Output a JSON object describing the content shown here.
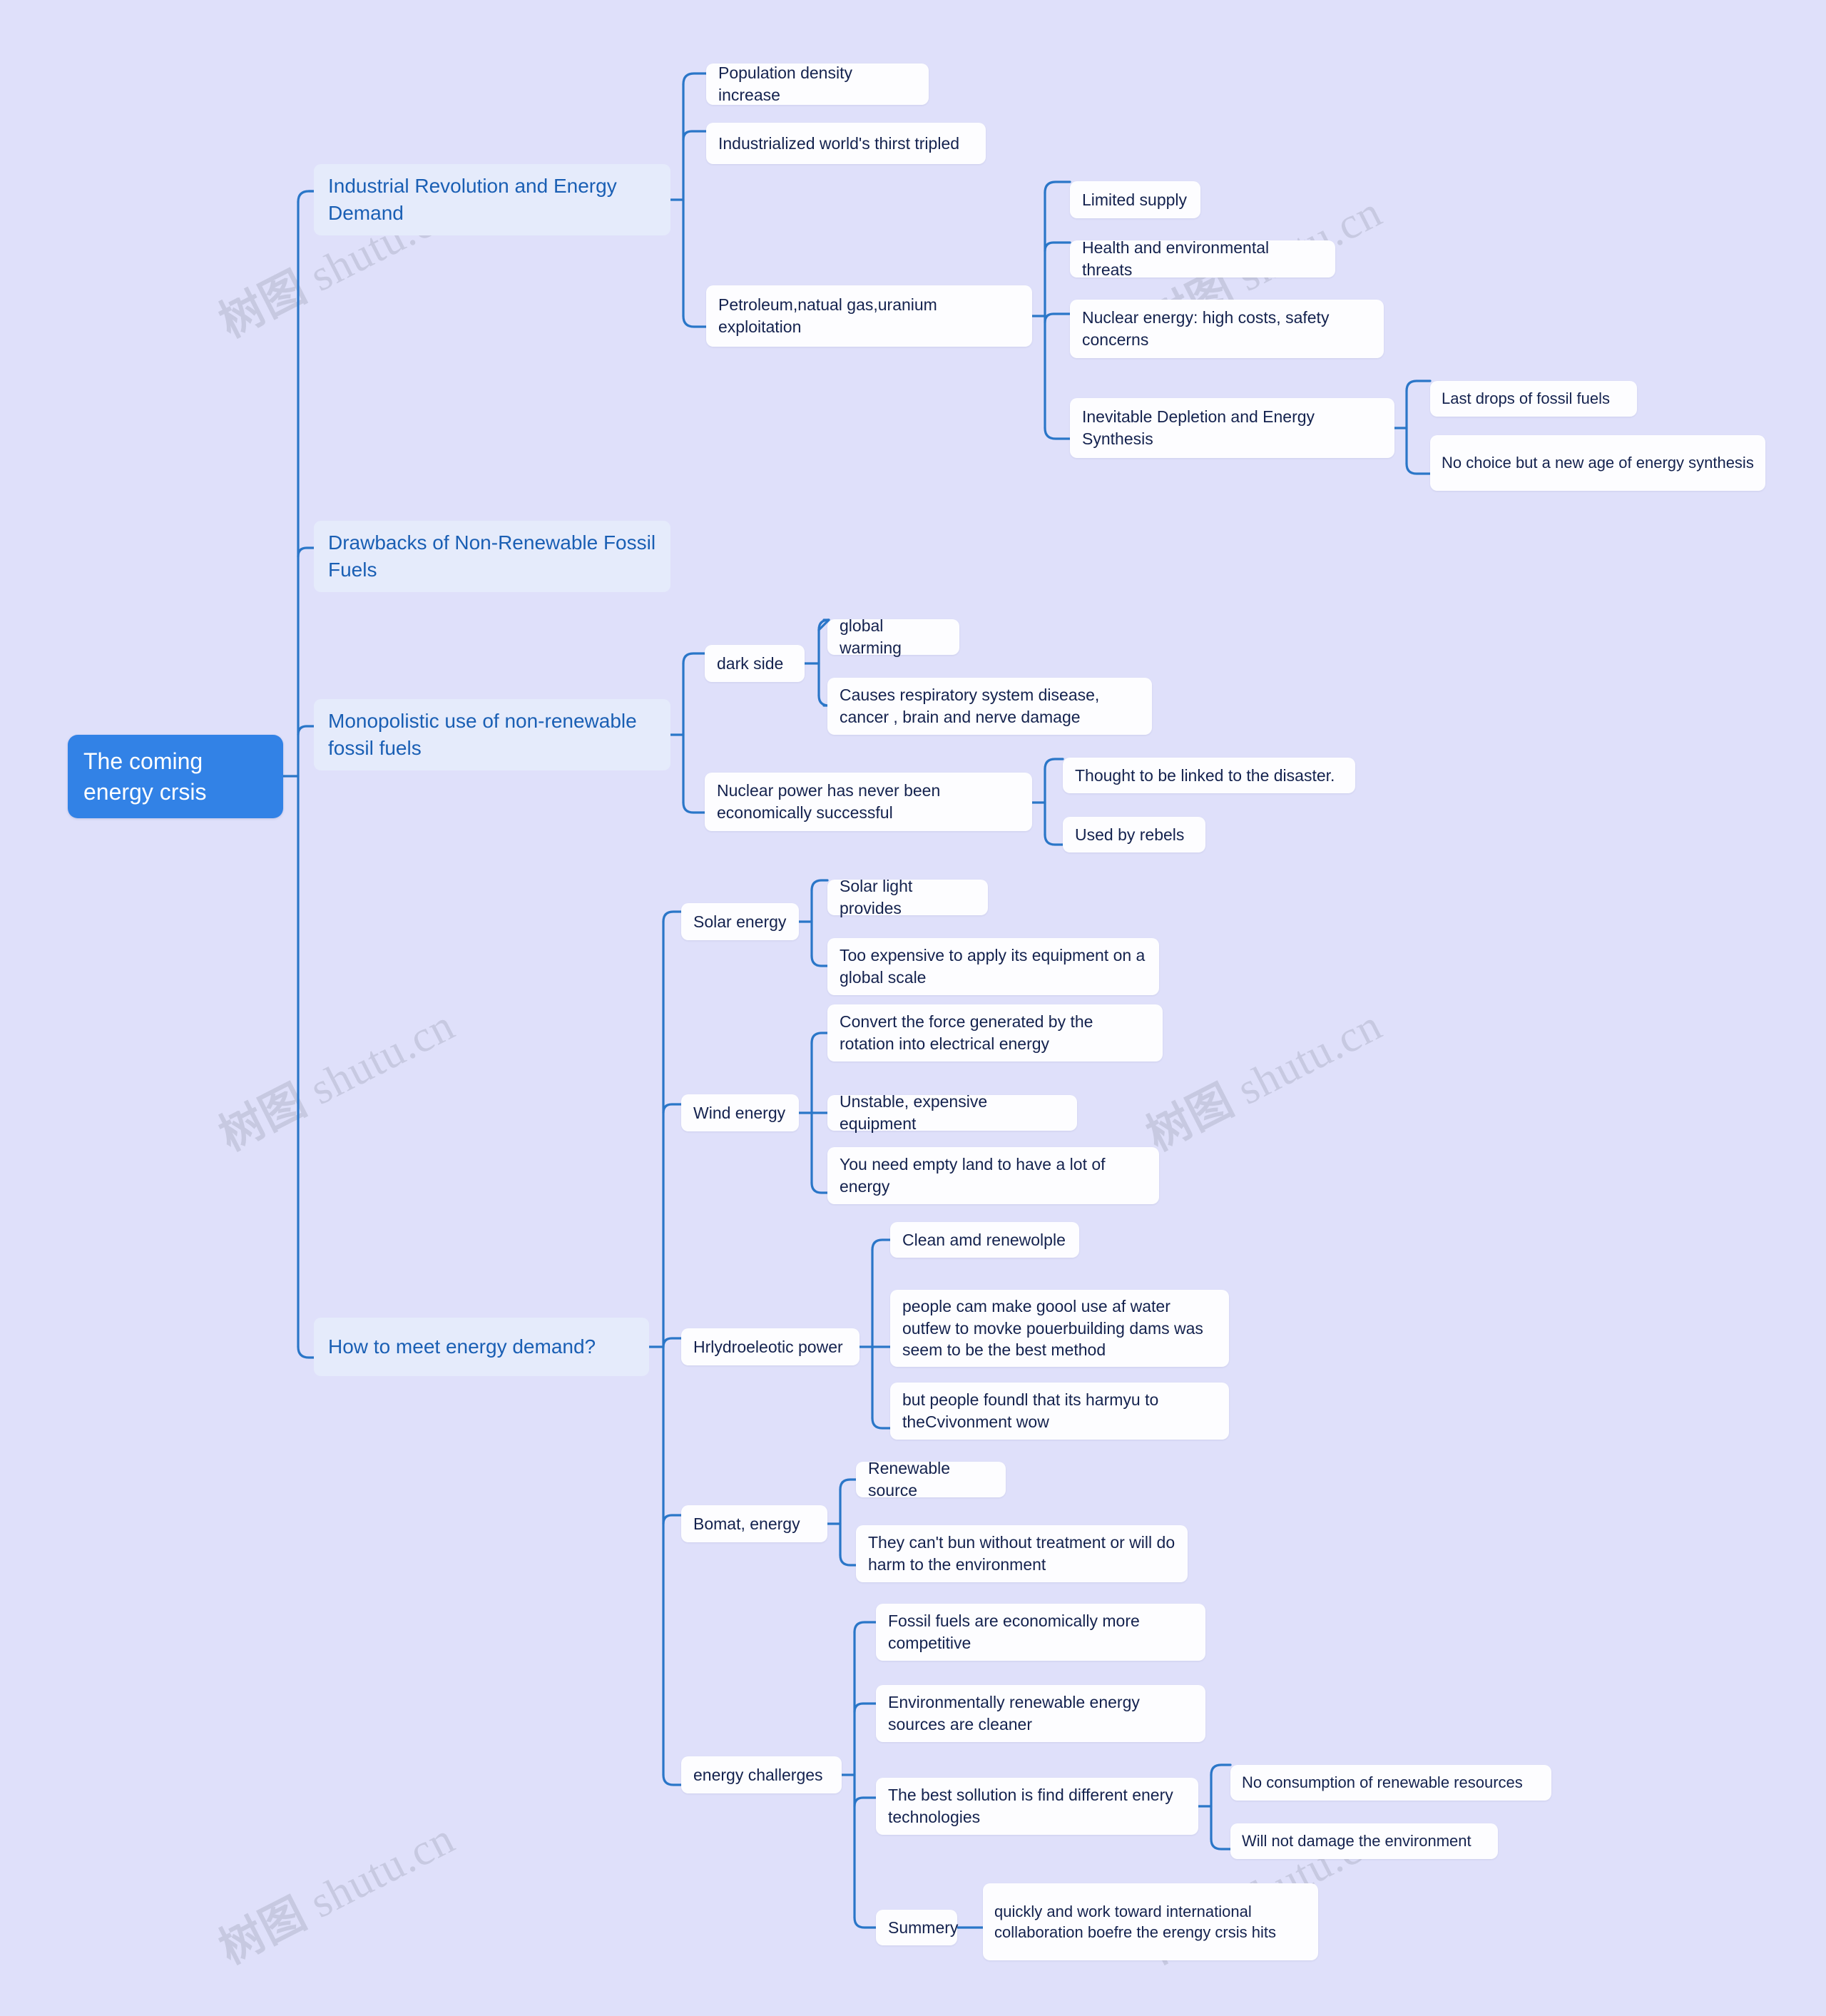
{
  "theme": {
    "background": "#dfe0fa",
    "root_fill": "#3282e6",
    "root_text": "#ffffff",
    "level1_fill": "#e5ebfb",
    "level1_text": "#1a5fb4",
    "node_fill": "#fdfdff",
    "node_text": "#14224e",
    "link_color": "#2a76c8"
  },
  "watermark": {
    "text": "树图 shutu.cn",
    "cjk": "树图",
    "latin": "shutu.cn"
  },
  "root": {
    "label": "The coming energy crsis"
  },
  "branches": [
    {
      "label": "Industrial Revolution and Energy Demand",
      "children": [
        {
          "label": "Population density increase",
          "children": []
        },
        {
          "label": "Industrialized world's thirst tripled",
          "children": []
        },
        {
          "label": "Petroleum,natual gas,uranium exploitation",
          "children": [
            {
              "label": "Limited supply",
              "children": []
            },
            {
              "label": "Health and environmental threats",
              "children": []
            },
            {
              "label": "Nuclear energy: high costs, safety concerns",
              "children": []
            },
            {
              "label": "Inevitable Depletion and Energy Synthesis",
              "children": [
                {
                  "label": "Last drops of fossil fuels"
                },
                {
                  "label": "No choice but a new age of energy synthesis"
                }
              ]
            }
          ]
        }
      ]
    },
    {
      "label": "Drawbacks of Non-Renewable Fossil Fuels",
      "children": []
    },
    {
      "label": "Monopolistic use of non-renewable fossil fuels",
      "children": [
        {
          "label": "dark side",
          "children": [
            {
              "label": "global warming",
              "children": []
            },
            {
              "label": "Causes respiratory system disease, cancer , brain and nerve damage",
              "children": []
            }
          ]
        },
        {
          "label": "Nuclear power has never been economically successful",
          "children": [
            {
              "label": "Thought to be linked to the disaster.",
              "children": []
            },
            {
              "label": "Used by rebels",
              "children": []
            }
          ]
        }
      ]
    },
    {
      "label": "How to meet energy demand?",
      "children": [
        {
          "label": "Solar energy",
          "children": [
            {
              "label": "Solar light provides",
              "children": []
            },
            {
              "label": "Too expensive to apply its equipment on a global scale",
              "children": []
            }
          ]
        },
        {
          "label": "Wind energy",
          "children": [
            {
              "label": "Convert the force generated by the rotation into electrical energy",
              "children": []
            },
            {
              "label": "Unstable, expensive equipment",
              "children": []
            },
            {
              "label": "You need empty land to have a lot of energy",
              "children": []
            }
          ]
        },
        {
          "label": "Hrlydroeleotic power",
          "children": [
            {
              "label": "Clean amd renewolple",
              "children": []
            },
            {
              "label": "people cam make goool use af water outfew to movke pouerbuilding dams was seem to be the best method",
              "children": []
            },
            {
              "label": "but people foundl that its harmyu to theCvivonment wow",
              "children": []
            }
          ]
        },
        {
          "label": "Bomat, energy",
          "children": [
            {
              "label": "Renewable source",
              "children": []
            },
            {
              "label": "They can't bun without treatment or will do harm to the environment",
              "children": []
            }
          ]
        },
        {
          "label": "energy challerges",
          "children": [
            {
              "label": "Fossil fuels are economically more competitive",
              "children": []
            },
            {
              "label": "Environmentally renewable energy sources are cleaner",
              "children": []
            },
            {
              "label": "The best sollution is find different enery technologies",
              "children": [
                {
                  "label": "No consumption of renewable resources"
                },
                {
                  "label": "Will not damage the environment"
                }
              ]
            },
            {
              "label": "Summery",
              "children": [
                {
                  "label": "quickly and work toward international collaboration   boefre the erengy crsis hits"
                }
              ]
            }
          ]
        }
      ]
    }
  ]
}
